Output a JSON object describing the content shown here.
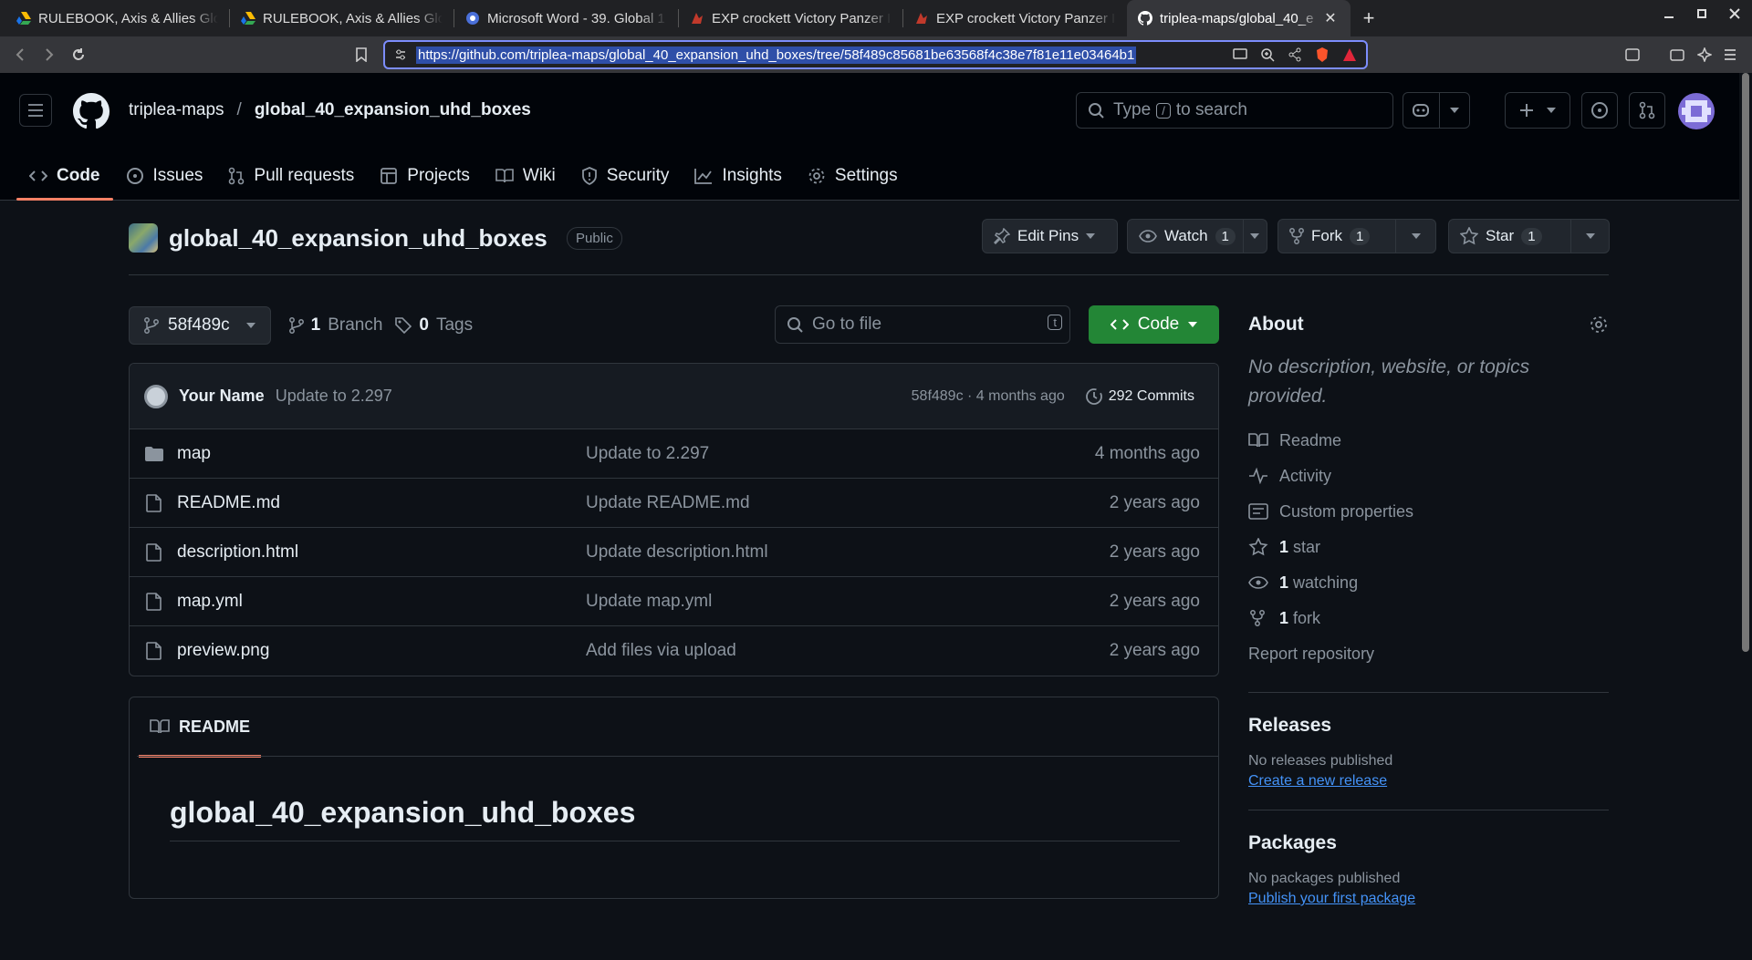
{
  "browser": {
    "tabs": [
      {
        "title": "RULEBOOK, Axis & Allies Glo",
        "icon": "drive-icon"
      },
      {
        "title": "RULEBOOK, Axis & Allies Glo",
        "icon": "drive-icon"
      },
      {
        "title": "Microsoft Word - 39. Global 1",
        "icon": "word-icon"
      },
      {
        "title": "EXP crockett Victory Panzer I",
        "icon": "forum-icon"
      },
      {
        "title": "EXP crockett Victory Panzer I",
        "icon": "forum-icon"
      },
      {
        "title": "triplea-maps/global_40_e",
        "icon": "github-icon"
      }
    ],
    "new_tab": "+",
    "close_glyph": "✕",
    "url": "https://github.com/triplea-maps/global_40_expansion_uhd_boxes/tree/58f489c85681be63568f4c38e7f81e11e03464b1"
  },
  "header": {
    "owner": "triplea-maps",
    "separator": "/",
    "repo": "global_40_expansion_uhd_boxes",
    "search_prefix": "Type",
    "search_key": "/",
    "search_suffix": "to search"
  },
  "nav": [
    {
      "label": "Code",
      "icon": "code-icon"
    },
    {
      "label": "Issues",
      "icon": "issue-icon"
    },
    {
      "label": "Pull requests",
      "icon": "pull-request-icon"
    },
    {
      "label": "Projects",
      "icon": "table-icon"
    },
    {
      "label": "Wiki",
      "icon": "book-icon"
    },
    {
      "label": "Security",
      "icon": "shield-icon"
    },
    {
      "label": "Insights",
      "icon": "graph-icon"
    },
    {
      "label": "Settings",
      "icon": "gear-icon"
    }
  ],
  "repo": {
    "name": "global_40_expansion_uhd_boxes",
    "visibility": "Public",
    "edit_pins": "Edit Pins",
    "watch": "Watch",
    "watch_count": "1",
    "fork": "Fork",
    "fork_count": "1",
    "star": "Star",
    "star_count": "1"
  },
  "branch": {
    "name": "58f489c",
    "branches_count": "1",
    "branches_label": "Branch",
    "tags_count": "0",
    "tags_label": "Tags",
    "goto_placeholder": "Go to file",
    "goto_key": "t",
    "code_button": "Code"
  },
  "commit": {
    "author": "Your Name",
    "message": "Update to 2.297",
    "hash_time": "58f489c · 4 months ago",
    "commits": "292 Commits"
  },
  "files": [
    {
      "name": "map",
      "type": "folder",
      "message": "Update to 2.297",
      "age": "4 months ago"
    },
    {
      "name": "README.md",
      "type": "file",
      "message": "Update README.md",
      "age": "2 years ago"
    },
    {
      "name": "description.html",
      "type": "file",
      "message": "Update description.html",
      "age": "2 years ago"
    },
    {
      "name": "map.yml",
      "type": "file",
      "message": "Update map.yml",
      "age": "2 years ago"
    },
    {
      "name": "preview.png",
      "type": "file",
      "message": "Add files via upload",
      "age": "2 years ago"
    }
  ],
  "readme": {
    "tab": "README",
    "title": "global_40_expansion_uhd_boxes"
  },
  "about": {
    "title": "About",
    "description": "No description, website, or topics provided.",
    "readme": "Readme",
    "activity": "Activity",
    "custom_properties": "Custom properties",
    "stars_count": "1",
    "stars_label": "star",
    "watching_count": "1",
    "watching_label": "watching",
    "forks_count": "1",
    "forks_label": "fork",
    "report": "Report repository"
  },
  "releases": {
    "title": "Releases",
    "note": "No releases published",
    "link": "Create a new release"
  },
  "packages": {
    "title": "Packages",
    "note": "No packages published",
    "link": "Publish your first package"
  },
  "colors": {
    "accent_green": "#238636",
    "link_blue": "#4493f8",
    "tab_underline": "#f78166"
  }
}
